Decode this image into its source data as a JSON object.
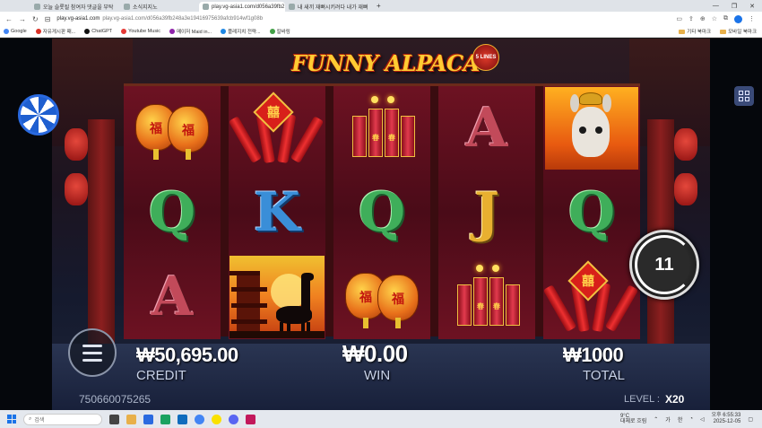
{
  "browser": {
    "tabs": [
      {
        "label": "오늘 슬롯될 참여자 댓글을 부탁",
        "active": false
      },
      {
        "label": "소식지지노",
        "active": false
      },
      {
        "label": "play.vg-asia1.com/d056a39fb2",
        "active": true
      },
      {
        "label": "내 새끼 재뻐시키려다 내가 재뻐",
        "active": false
      }
    ],
    "new_tab": "+",
    "url_host": "play.vg-asia1.com",
    "url_path": "play.vg-asia1.com/d056a39fb248a3e19416975639afcb914wf1g08b",
    "bookmarks": [
      "Google",
      "자유게시판 패...",
      "ChatGPT",
      "Youtube Music",
      "메이저 Maid in...",
      "플레지치 전략...",
      "칼바링"
    ],
    "bookmark_colors": [
      "#4285f4",
      "#d93025",
      "#111111",
      "#e53935",
      "#8e24aa",
      "#1e88e5",
      "#43a047"
    ],
    "bookmarks_right": [
      "기타 북마크",
      "모바일 북마크"
    ]
  },
  "game": {
    "logo": "FUNNY ALPACA",
    "lines_badge": "5 LINES",
    "reels": [
      [
        "lantern",
        "Q",
        "A"
      ],
      [
        "firecracker-bundle",
        "K",
        "pagoda-alpaca"
      ],
      [
        "firecrackers",
        "Q",
        "lantern"
      ],
      [
        "A",
        "J",
        "firecrackers"
      ],
      [
        "alpaca-wild",
        "Q",
        "firecracker-bundle"
      ]
    ],
    "free_spins": "11",
    "credit_value": "₩50,695.00",
    "credit_label": "CREDIT",
    "win_value": "₩0.00",
    "win_label": "WIN",
    "total_value": "₩1000",
    "total_label": "TOTAL",
    "round_id": "750660075265",
    "level_label": "LEVEL :",
    "level_value": "X20",
    "lantern_char": "福",
    "bundle_char": "囍",
    "cracker_char": "春"
  },
  "taskbar": {
    "search_placeholder": "검색",
    "weather_temp": "9°C",
    "weather_desc": "대체로 흐림",
    "ime": "가",
    "lang": "한",
    "time": "오후 6:55:33",
    "date": "2025-12-05"
  }
}
